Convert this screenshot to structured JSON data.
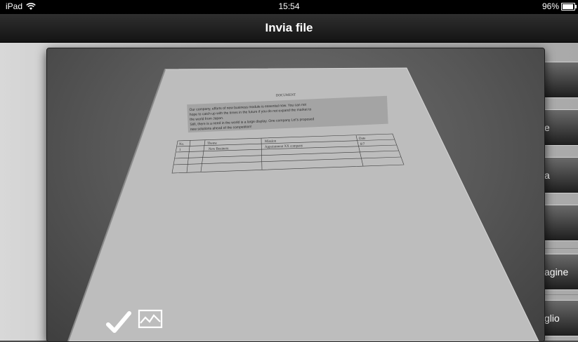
{
  "status_bar": {
    "device": "iPad",
    "time": "15:54",
    "battery": "96%"
  },
  "nav_bar": {
    "title": "Invia file"
  },
  "side_buttons": [
    {
      "label": ""
    },
    {
      "label": "e"
    },
    {
      "label": "a"
    },
    {
      "label": ""
    },
    {
      "label": "agine"
    },
    {
      "label": "glio"
    }
  ],
  "document": {
    "title": "DOCUMENT",
    "paragraph_lines": [
      "Our company, efforts of new business module is essential now. You can not",
      "hope to catch up with the times in the future if you do not expand the market to",
      "the world from Japan.",
      "Still, there is a need in the world is a large display. One company Let's proposed",
      "new solutions ahead of the competition!"
    ],
    "table": {
      "headers": [
        "No.",
        "Theme",
        "Mission",
        "Date"
      ],
      "rows": [
        [
          "1",
          "New Business",
          "Appointment XX company",
          "8/7"
        ]
      ]
    }
  },
  "icons": {
    "status_wifi": "wifi-icon",
    "confirm": "checkmark-icon",
    "enhance": "image-adjust-icon"
  },
  "colors": {
    "nav_bar": "#1f1f1f",
    "status_bar": "#000000",
    "side_button": "#3a3a3a"
  }
}
